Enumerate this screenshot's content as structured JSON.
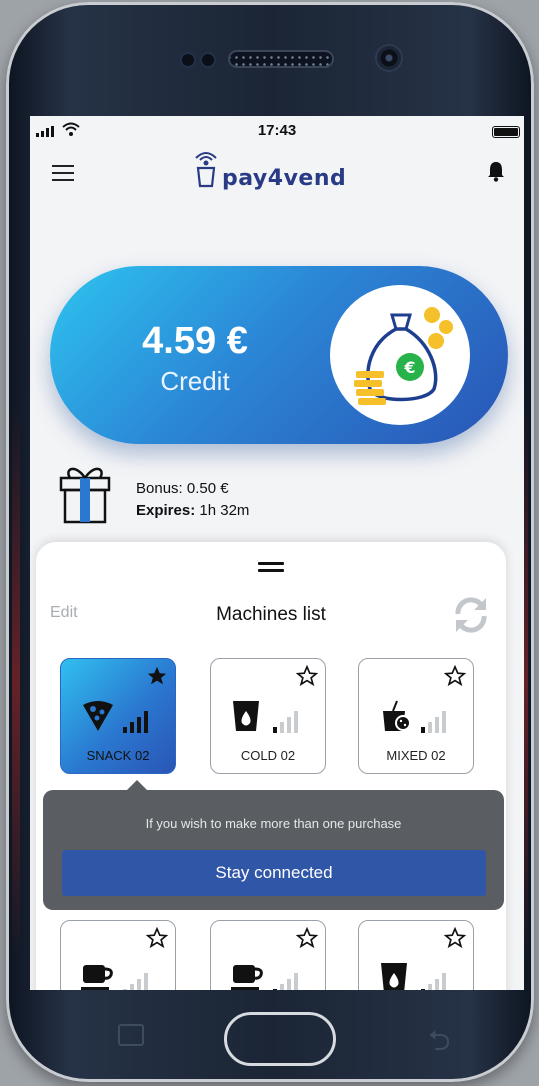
{
  "status": {
    "time": "17:43"
  },
  "app": {
    "logo_text": "pay4vend"
  },
  "credit": {
    "amount": "4.59 €",
    "label": "Credit"
  },
  "bonus": {
    "bonus_label": "Bonus:",
    "bonus_value": "0.50 €",
    "expires_label": "Expires:",
    "expires_value": "1h 32m"
  },
  "sheet": {
    "edit_label": "Edit",
    "title": "Machines list"
  },
  "machines": [
    {
      "label": "SNACK 02",
      "icon": "pizza-icon",
      "favorite": true,
      "selected": true
    },
    {
      "label": "COLD 02",
      "icon": "cold-cup-icon",
      "favorite": false,
      "selected": false
    },
    {
      "label": "MIXED 02",
      "icon": "mixed-icon",
      "favorite": false,
      "selected": false
    },
    {
      "label": "",
      "icon": "coffee-cup-icon",
      "favorite": false,
      "selected": false
    },
    {
      "label": "",
      "icon": "coffee-cup-icon",
      "favorite": false,
      "selected": false
    },
    {
      "label": "",
      "icon": "cold-cup-icon",
      "favorite": false,
      "selected": false
    }
  ],
  "tooltip": {
    "message": "If you wish to make more than one purchase",
    "button_label": "Stay connected"
  },
  "colors": {
    "accent": "#2a55b6",
    "accent_light": "#2ec4ef",
    "button": "#3056a8",
    "tooltip_bg": "#5a5e63",
    "coin": "#f5c02a",
    "bag": "#1e3f8f"
  }
}
